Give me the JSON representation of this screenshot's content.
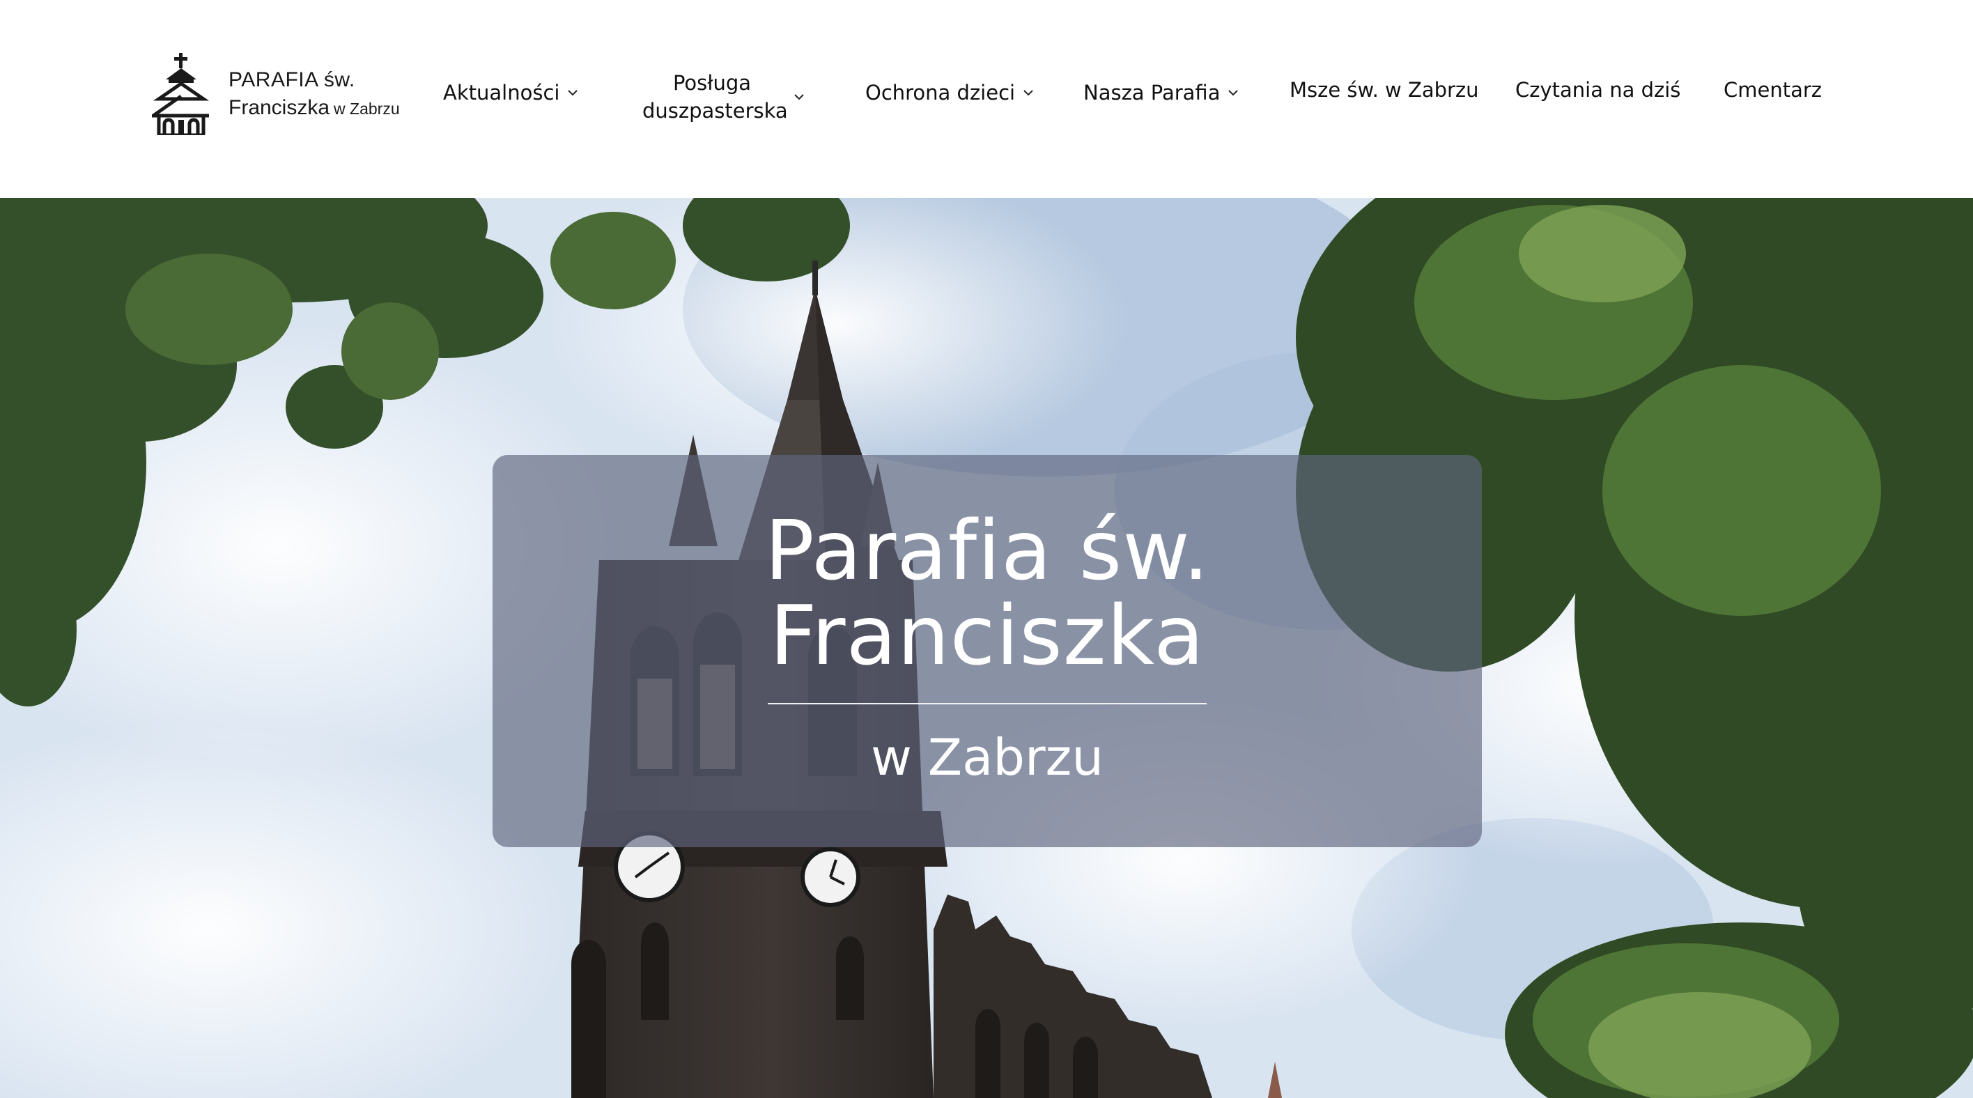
{
  "header": {
    "logo": {
      "line1": "PARAFIA św.",
      "line2": "Franciszka",
      "line2_small": "w Zabrzu",
      "icon": "church-icon"
    },
    "nav": [
      {
        "label": "Aktualności",
        "has_dropdown": true
      },
      {
        "label": "Posługa duszpasterska",
        "has_dropdown": true
      },
      {
        "label": "Ochrona dzieci",
        "has_dropdown": true
      },
      {
        "label": "Nasza Parafia",
        "has_dropdown": true
      },
      {
        "label": "Msze św. w Zabrzu",
        "has_dropdown": false
      },
      {
        "label": "Czytania na dziś",
        "has_dropdown": false
      },
      {
        "label": "Cmentarz",
        "has_dropdown": false
      }
    ]
  },
  "hero": {
    "title_line1": "Parafia św.",
    "title_line2": "Franciszka",
    "subtitle": "w Zabrzu",
    "background": "church-tower-photo"
  },
  "colors": {
    "overlay": "#5f667e",
    "text_dark": "#111111",
    "text_light": "#ffffff"
  }
}
